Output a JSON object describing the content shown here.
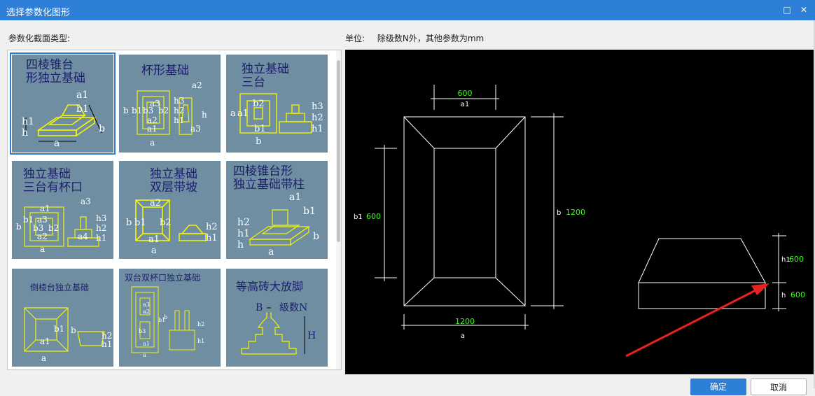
{
  "window": {
    "title": "选择参数化图形"
  },
  "left_panel": {
    "label": "参数化截面类型:"
  },
  "right_panel": {
    "unit_label": "单位:",
    "unit_text": "除级数N外，其他参数为mm"
  },
  "thumbnails": [
    {
      "caption": "四棱锥台\n形独立基础",
      "labels": [
        "a1",
        "b1",
        "h1",
        "h",
        "b",
        "a"
      ]
    },
    {
      "caption": "杯形基础",
      "labels": [
        "a2",
        "b",
        "b1",
        "b3",
        "b2",
        "a3",
        "a2",
        "a1",
        "a",
        "h3",
        "h2",
        "h1",
        "h",
        "a3"
      ]
    },
    {
      "caption": "独立基础\n三台",
      "labels": [
        "b2",
        "a1",
        "b1",
        "a",
        "b",
        "h3",
        "h2",
        "h1"
      ]
    },
    {
      "caption": "独立基础\n三台有杯口",
      "labels": [
        "a1",
        "a3",
        "b",
        "b1",
        "a3",
        "b3",
        "b2",
        "a2",
        "a",
        "a4",
        "h3",
        "h2",
        "h1"
      ]
    },
    {
      "caption": "独立基础\n双层带坡",
      "labels": [
        "a2",
        "b",
        "b1",
        "b2",
        "a1",
        "a",
        "h2",
        "h1"
      ]
    },
    {
      "caption": "四棱锥台形\n独立基础带柱",
      "labels": [
        "a1",
        "b1",
        "h2",
        "h1",
        "h",
        "b",
        "a"
      ]
    },
    {
      "caption": "倒棱台独立基础",
      "labels": [
        "b1",
        "a1",
        "a",
        "b",
        "h2",
        "h1"
      ]
    },
    {
      "caption": "双台双杯口独立基础",
      "labels": [
        "a3",
        "a2",
        "b3",
        "a1",
        "b1",
        "b",
        "a",
        "h2",
        "h1"
      ]
    },
    {
      "caption": "等高砖大放脚",
      "labels": [
        "B",
        "级数N",
        "H"
      ]
    }
  ],
  "preview": {
    "top_dim": {
      "value": "600",
      "label": "a1"
    },
    "bottom_dim": {
      "value": "1200",
      "label": "a"
    },
    "left_dim": {
      "label": "b1",
      "value": "600"
    },
    "right_dim": {
      "label": "b",
      "value": "1200"
    },
    "h1_dim": {
      "label": "h1",
      "value": "600"
    },
    "h_dim": {
      "label": "h",
      "value": "600"
    },
    "colors": {
      "line": "#ffffff",
      "value": "#39ff14",
      "arrow": "#e8231d"
    }
  },
  "buttons": {
    "ok": "确定",
    "cancel": "取消"
  }
}
